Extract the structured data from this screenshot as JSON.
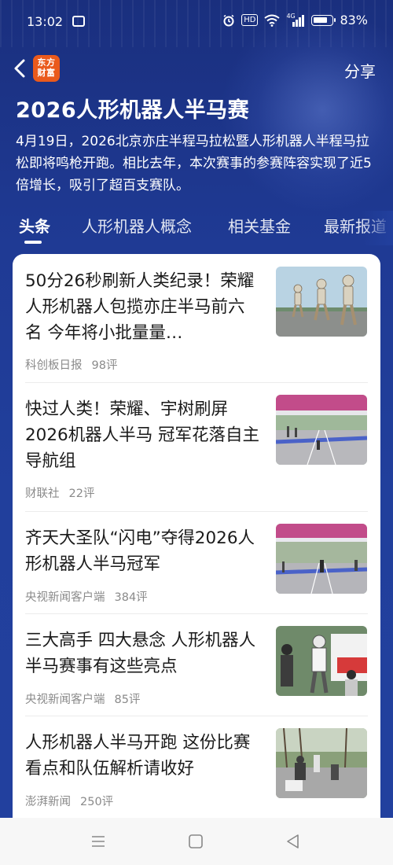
{
  "status_bar": {
    "time": "13:02",
    "network": "4G",
    "battery_percent_text": "83%",
    "battery_level": 0.83,
    "icons": [
      "message-icon",
      "alarm-icon",
      "hd-icon",
      "wifi-icon",
      "signal-icon",
      "battery-icon"
    ]
  },
  "header": {
    "logo_line1": "东方",
    "logo_line2": "财富",
    "share_label": "分享",
    "title": "2026人形机器人半马赛",
    "description": "4月19日，2026北京亦庄半程马拉松暨人形机器人半程马拉松即将鸣枪开跑。相比去年，本次赛事的参赛阵容实现了近5倍增长，吸引了超百支赛队。"
  },
  "tabs": [
    {
      "label": "头条",
      "active": true
    },
    {
      "label": "人形机器人概念",
      "active": false
    },
    {
      "label": "相关基金",
      "active": false
    },
    {
      "label": "最新报道",
      "active": false
    }
  ],
  "news": [
    {
      "title": "50分26秒刷新人类纪录！荣耀人形机器人包揽亦庄半马前六名 今年将小批量量…",
      "source": "科创板日报",
      "comments": "98评",
      "thumb": "three-robots-running-image"
    },
    {
      "title": "快过人类！荣耀、宇树刷屏2026机器人半马 冠军花落自主导航组",
      "source": "财联社",
      "comments": "22评",
      "thumb": "race-finish-line-image"
    },
    {
      "title": "齐天大圣队“闪电”夺得2026人形机器人半马冠军",
      "source": "央视新闻客户端",
      "comments": "384评",
      "thumb": "robot-crossing-finish-image"
    },
    {
      "title": "三大高手 四大悬念 人形机器人半马赛事有这些亮点",
      "source": "央视新闻客户端",
      "comments": "85评",
      "thumb": "robot-with-team-image"
    },
    {
      "title": "人形机器人半马开跑 这份比赛看点和队伍解析请收好",
      "source": "澎湃新闻",
      "comments": "250评",
      "thumb": "robot-runners-street-image"
    }
  ],
  "nav_bar": {
    "icons": [
      "menu-icon",
      "home-square-icon",
      "back-triangle-icon"
    ]
  },
  "colors": {
    "hero_blue": "#1f3a94",
    "logo_orange": "#ea5a1c",
    "text_dark": "#1a1a1a",
    "meta_gray": "#8a8a8a"
  }
}
